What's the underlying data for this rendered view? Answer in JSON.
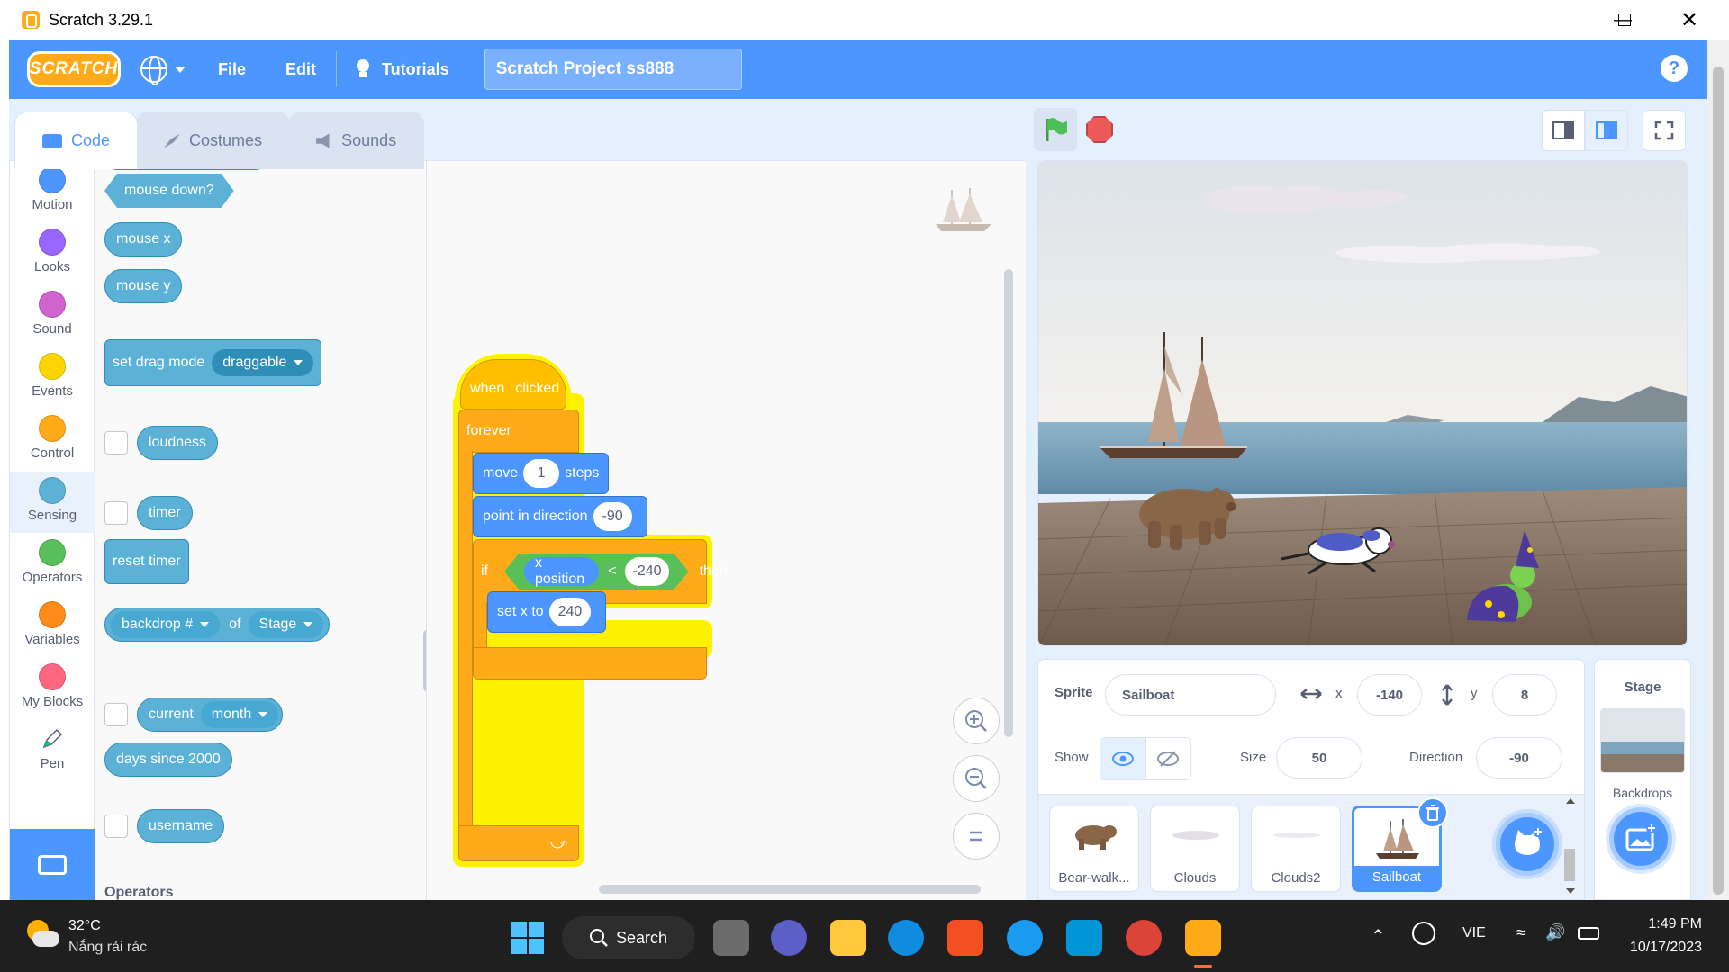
{
  "window": {
    "title": "Scratch 3.29.1"
  },
  "menubar": {
    "logo": "SCRATCH",
    "file": "File",
    "edit": "Edit",
    "tutorials": "Tutorials",
    "project_name": "Scratch Project ss888",
    "help": "?"
  },
  "tabs": [
    {
      "label": "Code"
    },
    {
      "label": "Costumes"
    },
    {
      "label": "Sounds"
    }
  ],
  "categories": [
    {
      "label": "Motion",
      "color": "#4c97ff"
    },
    {
      "label": "Looks",
      "color": "#9966ff"
    },
    {
      "label": "Sound",
      "color": "#cf63cf"
    },
    {
      "label": "Events",
      "color": "#ffd500"
    },
    {
      "label": "Control",
      "color": "#ffab19"
    },
    {
      "label": "Sensing",
      "color": "#5cb1d6"
    },
    {
      "label": "Operators",
      "color": "#59c059"
    },
    {
      "label": "Variables",
      "color": "#ff8c1a"
    },
    {
      "label": "My Blocks",
      "color": "#ff6680"
    },
    {
      "label": "Pen",
      "color": "#0fbd8c"
    }
  ],
  "palette": {
    "mouse_down": "mouse down?",
    "mouse_x": "mouse x",
    "mouse_y": "mouse y",
    "set_drag_mode": "set drag mode",
    "drag_value": "draggable",
    "loudness": "loudness",
    "timer": "timer",
    "reset_timer": "reset timer",
    "backdrop": "backdrop #",
    "of": "of",
    "stage": "Stage",
    "current": "current",
    "month": "month",
    "days_since": "days since 2000",
    "username": "username",
    "operators_heading": "Operators"
  },
  "script": {
    "when": "when",
    "clicked": "clicked",
    "forever": "forever",
    "move": "move",
    "move_value": "1",
    "steps": "steps",
    "point_in_direction": "point in direction",
    "direction_value": "-90",
    "if": "if",
    "x_position": "x position",
    "lt": "<",
    "compare_value": "-240",
    "then": "then",
    "set_x_to": "set x to",
    "set_x_value": "240"
  },
  "sprite_info": {
    "sprite_label": "Sprite",
    "sprite_name": "Sailboat",
    "x_label": "x",
    "x_value": "-140",
    "y_label": "y",
    "y_value": "8",
    "show_label": "Show",
    "size_label": "Size",
    "size_value": "50",
    "direction_label": "Direction",
    "direction_value": "-90"
  },
  "sprites": [
    {
      "name": "Bear-walk..."
    },
    {
      "name": "Clouds"
    },
    {
      "name": "Clouds2"
    },
    {
      "name": "Sailboat"
    }
  ],
  "stage_panel": {
    "title": "Stage",
    "backdrops": "Backdrops"
  },
  "taskbar": {
    "temp": "32°C",
    "weather": "Nắng rải rác",
    "search": "Search",
    "lang": "VIE",
    "time": "1:49 PM",
    "date": "10/17/2023"
  }
}
